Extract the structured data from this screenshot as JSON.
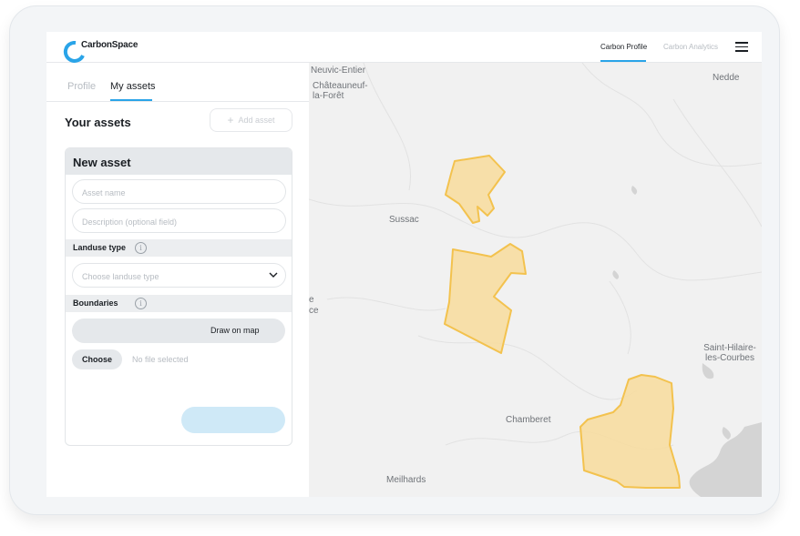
{
  "app": {
    "brand": "CarbonSpace"
  },
  "header": {
    "nav": [
      {
        "label": "Carbon Profile",
        "active": true
      },
      {
        "label": "Carbon Analytics",
        "active": false
      }
    ]
  },
  "panel": {
    "tabs": [
      {
        "label": "Profile",
        "active": false
      },
      {
        "label": "My assets",
        "active": true
      }
    ],
    "title": "Your assets",
    "add_button": "Add asset",
    "form": {
      "title": "New asset",
      "asset_name_placeholder": "Asset name",
      "description_placeholder": "Description (optional field)",
      "landuse_label": "Landuse type",
      "landuse_placeholder": "Choose landuse type",
      "boundaries_label": "Boundaries",
      "draw_button": "Draw on map",
      "choose_button": "Choose",
      "file_status": "No file selected",
      "submit_label": ""
    }
  },
  "map": {
    "places": [
      "Neuvic-Entier",
      "Châteauneuf-la-Forêt",
      "Nedde",
      "Sussac",
      "Saint-Hilaire-les-Courbes",
      "Chamberet",
      "Meilhards",
      "e",
      "ce"
    ],
    "polygon_fill": "#f8dc9c",
    "polygon_stroke": "#f3c24e",
    "polygons": [
      "asset-boundary-north",
      "asset-boundary-central",
      "asset-boundary-southeast"
    ]
  },
  "colors": {
    "accent": "#2aa4e8",
    "submit_disabled": "#cfe9f7"
  }
}
